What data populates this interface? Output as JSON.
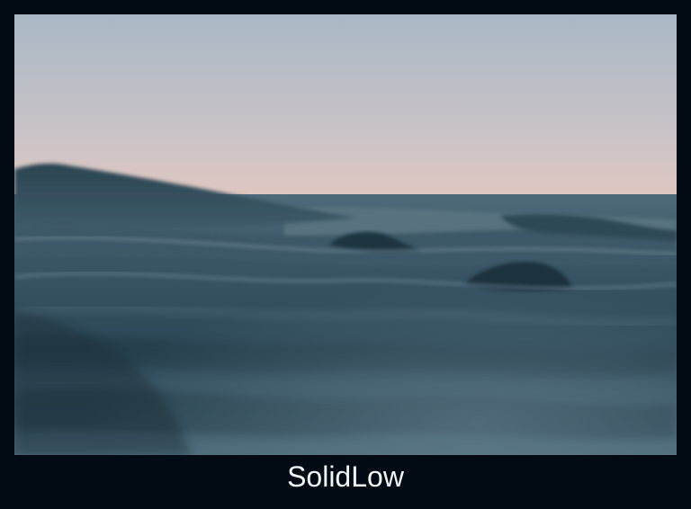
{
  "photo": {
    "subject": "ocean-surface-waves-at-dusk",
    "colors": {
      "sky_top": "#aab8c4",
      "sky_bottom": "#e9c8bd",
      "water_light": "#6c8696",
      "water_mid": "#3d5968",
      "water_dark": "#1e3340",
      "frame_bg": "#020a13"
    }
  },
  "caption": {
    "text": "SolidLow"
  }
}
